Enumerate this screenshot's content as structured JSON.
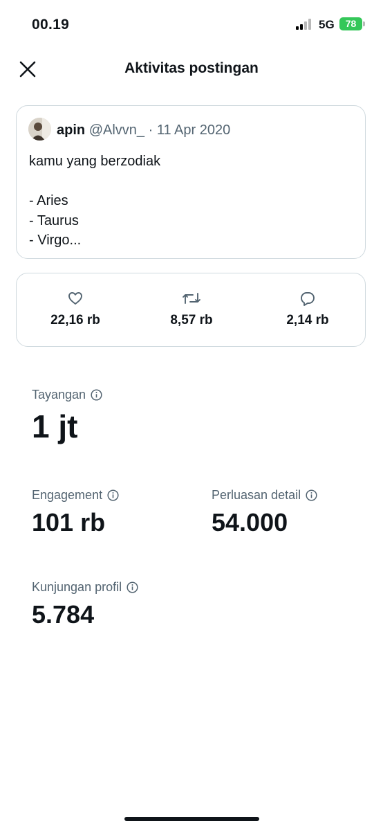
{
  "status_bar": {
    "time": "00.19",
    "network": "5G",
    "battery": "78"
  },
  "header": {
    "title": "Aktivitas postingan"
  },
  "post": {
    "author_name": "apin",
    "author_handle": "@Alvvn_",
    "separator": "·",
    "date": "11 Apr 2020",
    "text": "kamu yang berzodiak\n\n- Aries\n- Taurus\n- Virgo..."
  },
  "engagement_stats": {
    "likes": "22,16 rb",
    "reposts": "8,57 rb",
    "replies": "2,14 rb"
  },
  "metrics": {
    "impressions": {
      "label": "Tayangan",
      "value": "1 jt"
    },
    "engagements": {
      "label": "Engagement",
      "value": "101 rb"
    },
    "detail_expands": {
      "label": "Perluasan detail",
      "value": "54.000"
    },
    "profile_visits": {
      "label": "Kunjungan profil",
      "value": "5.784"
    }
  },
  "icons": {
    "close": "close-icon",
    "like": "heart-icon",
    "repost": "repost-icon",
    "reply": "reply-icon",
    "info": "info-icon"
  },
  "colors": {
    "text": "#0f1419",
    "secondary": "#536471",
    "border": "#cfd9de",
    "battery": "#34c759"
  }
}
